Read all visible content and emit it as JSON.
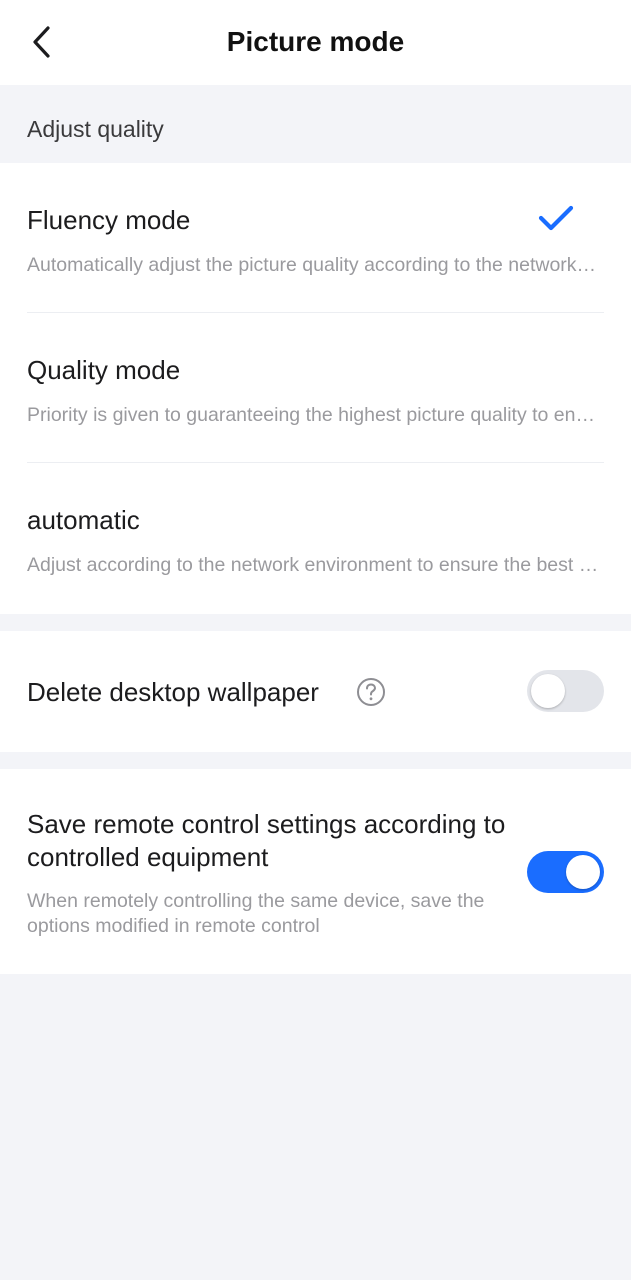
{
  "header": {
    "title": "Picture mode",
    "back_icon": "chevron-left-icon"
  },
  "section": {
    "label": "Adjust quality"
  },
  "options": [
    {
      "title": "Fluency mode",
      "desc": "Automatically adjust the picture quality according to the network environment",
      "selected": true
    },
    {
      "title": "Quality mode",
      "desc": "Priority is given to guaranteeing the highest picture quality to ensure the best clarity",
      "selected": false
    },
    {
      "title": "automatic",
      "desc": "Adjust according to the network environment to ensure the best experience",
      "selected": false
    }
  ],
  "wallpaper": {
    "label": "Delete desktop wallpaper",
    "help_icon": "question-circle-icon",
    "enabled": false
  },
  "save_settings": {
    "label": "Save remote control settings according to controlled equipment",
    "desc": "When remotely controlling the same device, save the options modified in remote control",
    "enabled": true
  },
  "colors": {
    "accent": "#1a6dff",
    "toggle_off": "#e3e5ea",
    "background": "#f3f4f8"
  }
}
